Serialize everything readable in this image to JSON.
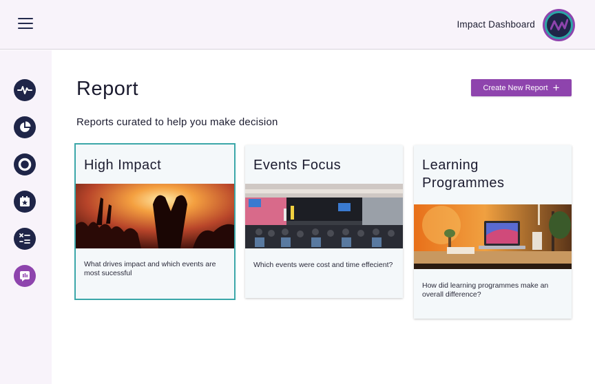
{
  "header": {
    "app_title": "Impact Dashboard",
    "menu_icon": "hamburger-menu-icon",
    "avatar_icon": "brand-logo-avatar"
  },
  "sidebar": {
    "items": [
      {
        "icon": "activity-pulse-icon"
      },
      {
        "icon": "pie-chart-icon"
      },
      {
        "icon": "target-icon"
      },
      {
        "icon": "calendar-star-icon"
      },
      {
        "icon": "calculator-icon"
      },
      {
        "icon": "reports-icon",
        "active": true
      }
    ]
  },
  "main": {
    "title": "Report",
    "subtitle": "Reports curated to help you make decision",
    "create_button": "Create New Report"
  },
  "cards": [
    {
      "title": "High Impact",
      "image": "concert-crowd-image",
      "description": "What drives impact and which events are most sucessful",
      "selected": true
    },
    {
      "title": "Events Focus",
      "image": "conference-hall-image",
      "description": "Which events were cost and time effecient?",
      "selected": false
    },
    {
      "title": "Learning Programmes",
      "image": "laptop-desk-image",
      "description": "How did learning programmes make an overall difference?",
      "selected": false
    }
  ],
  "colors": {
    "accent": "#8e44ad",
    "navy": "#1f2548",
    "teal": "#3aa6a8",
    "sidebar_bg": "#f8f3fa",
    "card_bg": "#f4f8fa"
  }
}
